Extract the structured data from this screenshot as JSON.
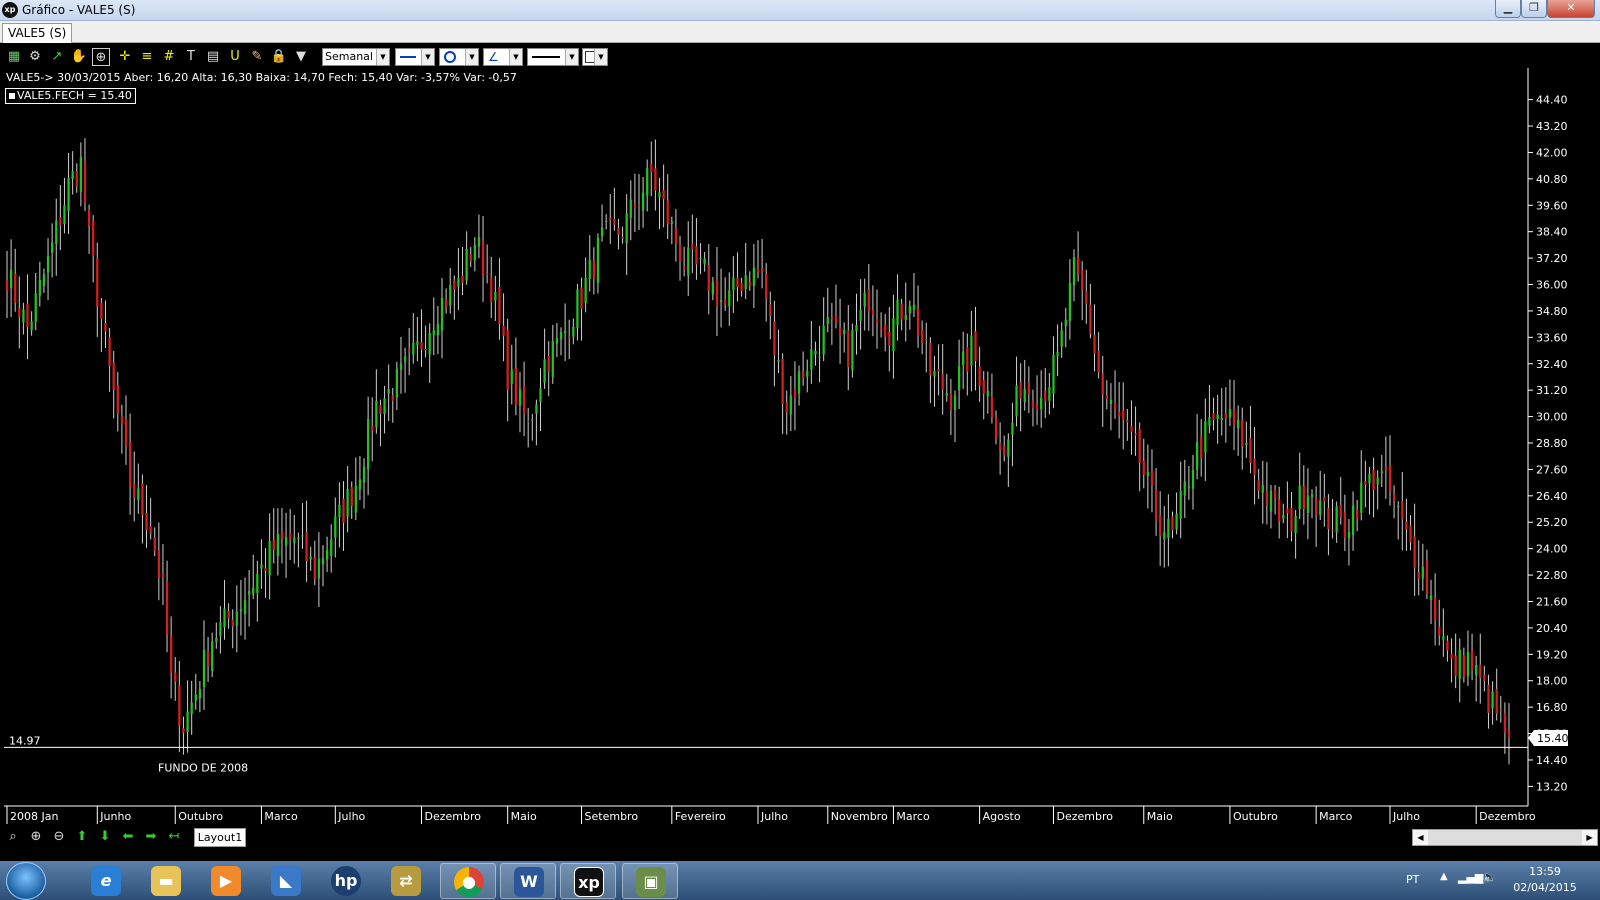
{
  "window": {
    "title": "Gráfico - VALE5 (S)",
    "app_icon": "xp",
    "min": "▁",
    "max": "❐",
    "close": "✕"
  },
  "tab": {
    "label": "VALE5 (S)"
  },
  "toolbar": {
    "period_select": "Semanal",
    "icons": [
      "chart-icon",
      "gear-icon",
      "trend-icon",
      "hand-icon",
      "zoom-cursor-icon",
      "crosshair-icon",
      "fibonacci-icon",
      "grid-icon",
      "text-icon",
      "calculator-icon",
      "magnet-icon",
      "eraser-icon",
      "lock-icon",
      "filter-icon"
    ]
  },
  "ohlc_info": "VALE5-> 30/03/2015 Aber: 16,20 Alta: 16,30 Baixa: 14,70 Fech: 15,40 Var: -3,57% Var: -0,57",
  "legend": {
    "label": "VALE5.FECH = 15.40"
  },
  "bottom": {
    "layout_tab": "Layout1"
  },
  "taskbar": {
    "lang": "PT",
    "time": "13:59",
    "date": "02/04/2015"
  },
  "colors": {
    "up": "#22c322",
    "down": "#d42020",
    "wick": "#cfcfcf",
    "line": "#ffffff",
    "bg": "#000000",
    "text": "#ffffff"
  },
  "chart_data": {
    "type": "candlestick",
    "period": "Semanal",
    "ylim": [
      12.4,
      45.2
    ],
    "yticks": [
      44.4,
      43.2,
      42.0,
      40.8,
      39.6,
      38.4,
      37.2,
      36.0,
      34.8,
      33.6,
      32.4,
      31.2,
      30.0,
      28.8,
      27.6,
      26.4,
      25.2,
      24.0,
      22.8,
      21.6,
      20.4,
      19.2,
      18.0,
      16.8,
      15.6,
      14.4,
      13.2
    ],
    "last_price": 15.4,
    "horizontal_line": {
      "value": 14.97,
      "label": "14.97",
      "annotation": "FUNDO DE 2008"
    },
    "x_labels": [
      "2008 Jan",
      "Junho",
      "Outubro",
      "Marco",
      "Julho",
      "Dezembro",
      "Maio",
      "Setembro",
      "Fevereiro",
      "Julho",
      "Novembro",
      "Marco",
      "Agosto",
      "Dezembro",
      "Maio",
      "Outubro",
      "Marco",
      "Julho",
      "Dezembro"
    ],
    "x_label_weeks": [
      0,
      22,
      41,
      62,
      80,
      101,
      122,
      140,
      162,
      183,
      200,
      216,
      237,
      255,
      277,
      298,
      319,
      337,
      358
    ],
    "close_anchors": [
      [
        0,
        36.5
      ],
      [
        5,
        34.0
      ],
      [
        10,
        37.0
      ],
      [
        15,
        40.5
      ],
      [
        18,
        41.5
      ],
      [
        20,
        38.0
      ],
      [
        25,
        32.0
      ],
      [
        30,
        27.0
      ],
      [
        35,
        25.0
      ],
      [
        38,
        22.0
      ],
      [
        40,
        18.0
      ],
      [
        43,
        16.0
      ],
      [
        46,
        17.5
      ],
      [
        50,
        20.0
      ],
      [
        55,
        21.0
      ],
      [
        60,
        22.5
      ],
      [
        65,
        24.0
      ],
      [
        70,
        24.5
      ],
      [
        75,
        23.0
      ],
      [
        80,
        25.0
      ],
      [
        85,
        27.0
      ],
      [
        90,
        30.5
      ],
      [
        95,
        31.5
      ],
      [
        100,
        33.0
      ],
      [
        105,
        35.0
      ],
      [
        110,
        36.0
      ],
      [
        114,
        38.0
      ],
      [
        118,
        36.0
      ],
      [
        122,
        32.0
      ],
      [
        127,
        29.5
      ],
      [
        131,
        32.5
      ],
      [
        135,
        33.5
      ],
      [
        140,
        35.5
      ],
      [
        145,
        38.0
      ],
      [
        150,
        38.5
      ],
      [
        154,
        40.0
      ],
      [
        157,
        41.0
      ],
      [
        160,
        39.5
      ],
      [
        165,
        37.0
      ],
      [
        170,
        36.5
      ],
      [
        175,
        35.0
      ],
      [
        180,
        36.5
      ],
      [
        184,
        36.5
      ],
      [
        187,
        33.0
      ],
      [
        190,
        30.5
      ],
      [
        195,
        32.5
      ],
      [
        200,
        34.0
      ],
      [
        205,
        33.0
      ],
      [
        210,
        35.5
      ],
      [
        215,
        34.0
      ],
      [
        220,
        35.5
      ],
      [
        225,
        32.0
      ],
      [
        230,
        31.0
      ],
      [
        235,
        33.0
      ],
      [
        240,
        30.5
      ],
      [
        243,
        28.0
      ],
      [
        247,
        31.5
      ],
      [
        252,
        31.0
      ],
      [
        256,
        32.5
      ],
      [
        260,
        36.5
      ],
      [
        263,
        35.0
      ],
      [
        267,
        31.0
      ],
      [
        272,
        29.5
      ],
      [
        276,
        28.0
      ],
      [
        280,
        25.5
      ],
      [
        284,
        24.5
      ],
      [
        289,
        28.0
      ],
      [
        293,
        29.5
      ],
      [
        297,
        30.0
      ],
      [
        301,
        29.0
      ],
      [
        304,
        27.5
      ],
      [
        308,
        26.0
      ],
      [
        312,
        25.0
      ],
      [
        317,
        27.0
      ],
      [
        321,
        25.5
      ],
      [
        326,
        25.0
      ],
      [
        330,
        26.5
      ],
      [
        334,
        27.5
      ],
      [
        337,
        26.5
      ],
      [
        341,
        24.5
      ],
      [
        345,
        23.0
      ],
      [
        349,
        20.5
      ],
      [
        352,
        18.5
      ],
      [
        356,
        19.0
      ],
      [
        360,
        17.5
      ],
      [
        363,
        16.5
      ],
      [
        366,
        15.4
      ]
    ]
  }
}
